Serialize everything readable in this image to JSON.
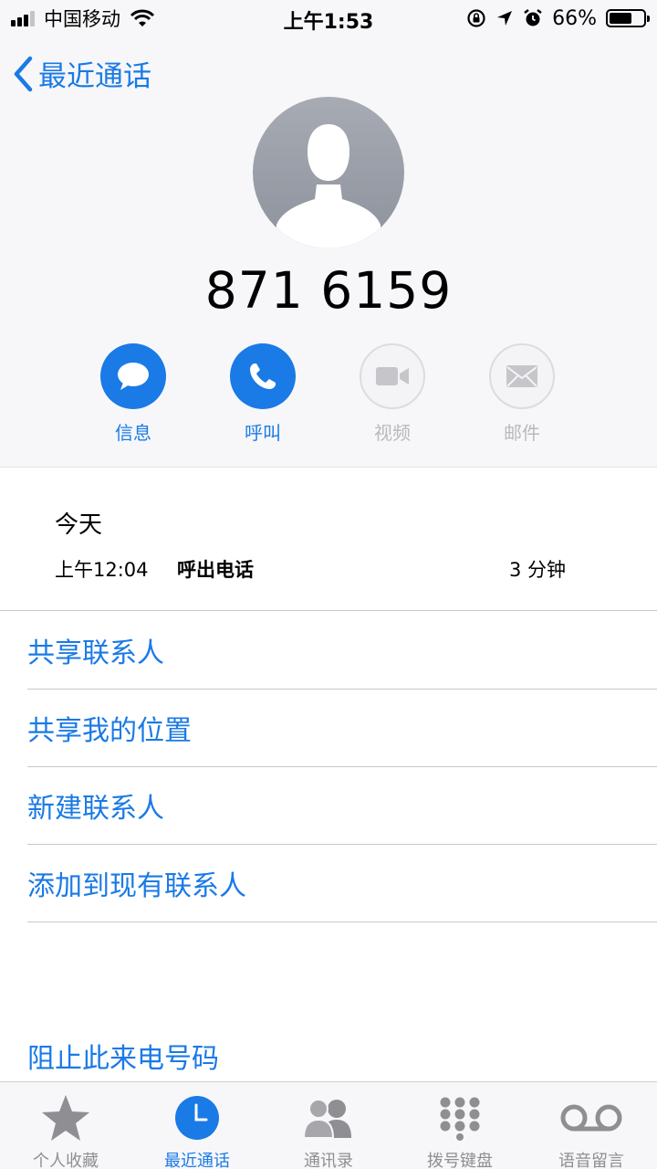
{
  "status_bar": {
    "carrier": "中国移动",
    "time": "上午1:53",
    "battery": "66%",
    "battery_level": 0.66
  },
  "header": {
    "back_label": "最近通话",
    "phone_number": "871 6159"
  },
  "actions": [
    {
      "label": "信息",
      "icon": "message-icon",
      "enabled": true
    },
    {
      "label": "呼叫",
      "icon": "phone-icon",
      "enabled": true
    },
    {
      "label": "视频",
      "icon": "video-icon",
      "enabled": false
    },
    {
      "label": "邮件",
      "icon": "mail-icon",
      "enabled": false
    }
  ],
  "history": {
    "day": "今天",
    "entries": [
      {
        "time": "上午12:04",
        "type": "呼出电话",
        "duration": "3 分钟"
      }
    ]
  },
  "menu": {
    "items": [
      "共享联系人",
      "共享我的位置",
      "新建联系人",
      "添加到现有联系人"
    ],
    "block": "阻止此来电号码"
  },
  "tabbar": {
    "tabs": [
      {
        "label": "个人收藏",
        "icon": "star-icon",
        "active": false
      },
      {
        "label": "最近通话",
        "icon": "clock-icon",
        "active": true
      },
      {
        "label": "通讯录",
        "icon": "contacts-icon",
        "active": false
      },
      {
        "label": "拨号键盘",
        "icon": "keypad-icon",
        "active": false
      },
      {
        "label": "语音留言",
        "icon": "voicemail-icon",
        "active": false
      }
    ]
  },
  "colors": {
    "accent": "#1a7ae6",
    "disabled": "#b9b9bd",
    "inactive_tab": "#8e8e93"
  }
}
